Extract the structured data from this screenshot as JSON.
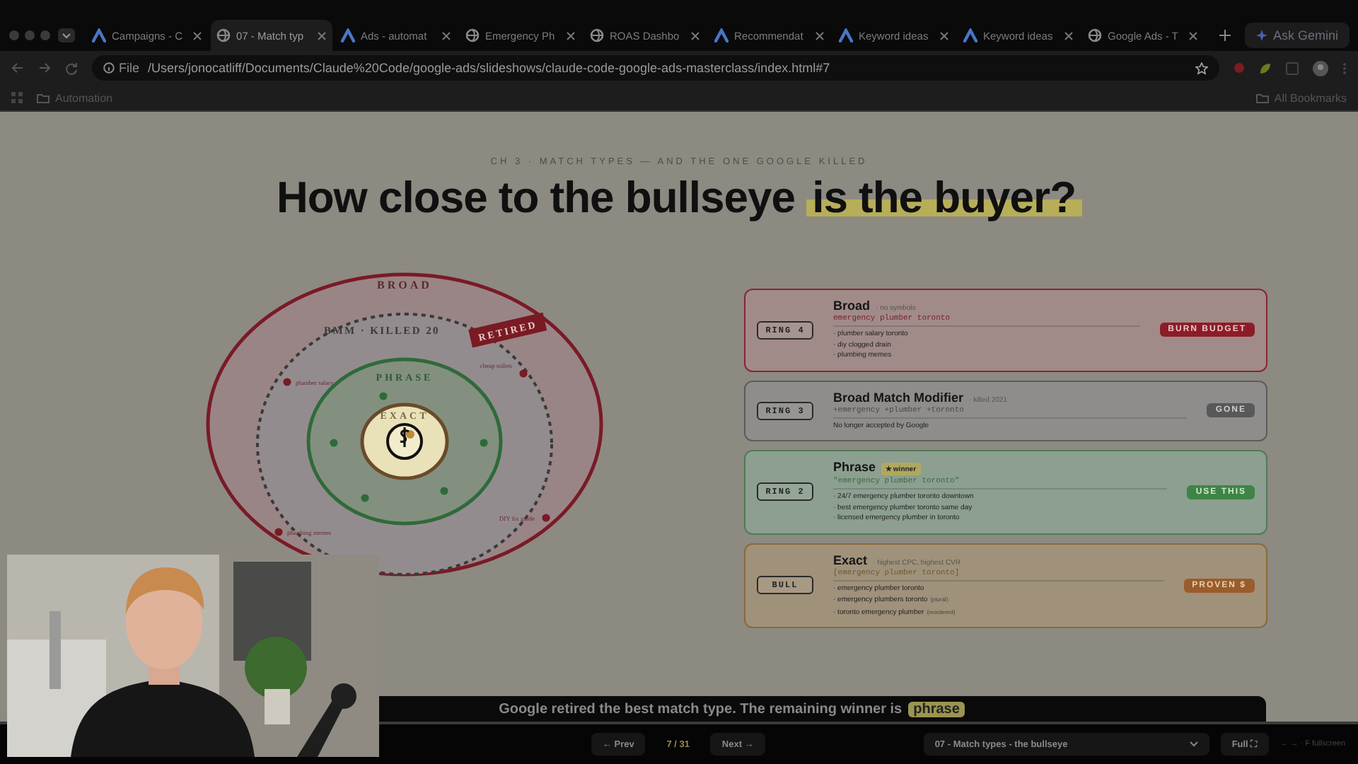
{
  "browser": {
    "tabs": [
      {
        "label": "Campaigns - C",
        "kind": "ads",
        "selected": false
      },
      {
        "label": "07 - Match typ",
        "kind": "globe",
        "selected": true
      },
      {
        "label": "Ads - automat",
        "kind": "ads",
        "selected": false
      },
      {
        "label": "Emergency Ph",
        "kind": "globe",
        "selected": false
      },
      {
        "label": "ROAS Dashbo",
        "kind": "globe",
        "selected": false
      },
      {
        "label": "Recommendat",
        "kind": "ads",
        "selected": false
      },
      {
        "label": "Keyword ideas",
        "kind": "ads",
        "selected": false
      },
      {
        "label": "Keyword ideas",
        "kind": "ads",
        "selected": false
      },
      {
        "label": "Google Ads - T",
        "kind": "globe",
        "selected": false
      }
    ],
    "gemini": "Ask Gemini",
    "scheme": "File",
    "url": "/Users/jonocatliff/Documents/Claude%20Code/google-ads/slideshows/claude-code-google-ads-masterclass/index.html#7",
    "bookmarks": [
      "Automation"
    ],
    "all_bookmarks": "All Bookmarks"
  },
  "slide": {
    "eyebrow": "CH 3 · MATCH TYPES — AND THE ONE GOOGLE KILLED",
    "title": "How close to the bullseye",
    "title_highlight": "is the buyer?",
    "diagram": {
      "broad": "BROAD",
      "bmm": "BMM · KILLED 20",
      "stamp": "RETIRED",
      "phrase": "PHRASE",
      "exact": "EXACT",
      "outliers": [
        "plumber salary",
        "cheap toilets",
        "DIY fix guide",
        "plumbing memes"
      ]
    },
    "cards": [
      {
        "kind": "broad",
        "ring": "RING 4",
        "title": "Broad",
        "note": "· no symbols",
        "query": "emergency plumber toronto",
        "lines": [
          {
            "text": "· plumber salary toronto"
          },
          {
            "text": "· diy clogged drain"
          },
          {
            "text": "· plumbing memes"
          }
        ],
        "pill": "BURN BUDGET"
      },
      {
        "kind": "bmm",
        "ring": "RING 3",
        "title": "Broad Match Modifier",
        "note": "· killed 2021",
        "query": "+emergency +plumber +toronto",
        "lines": [
          {
            "text": "No longer accepted by Google"
          }
        ],
        "pill": "GONE"
      },
      {
        "kind": "phrase",
        "ring": "RING 2",
        "title": "Phrase",
        "badge": "★ winner",
        "query": "\"emergency plumber toronto\"",
        "lines": [
          {
            "text": "· 24/7 emergency plumber toronto downtown"
          },
          {
            "text": "· best emergency plumber toronto same day"
          },
          {
            "text": "· licensed emergency plumber in toronto"
          }
        ],
        "pill": "USE THIS"
      },
      {
        "kind": "exact",
        "ring": "BULL",
        "title": "Exact",
        "note": "· highest CPC, highest CVR",
        "query": "[emergency plumber toronto]",
        "lines": [
          {
            "text": "· emergency plumber toronto"
          },
          {
            "text": "· emergency plumbers toronto",
            "tag": "(plural)"
          },
          {
            "text": "· toronto emergency plumber",
            "tag": "(reordered)"
          }
        ],
        "pill": "PROVEN $"
      }
    ],
    "caption": "Google retired the best match type. The remaining winner is",
    "caption_highlight": "phrase"
  },
  "nav": {
    "prev": "← Prev",
    "counter": "7 / 31",
    "next": "Next →",
    "section": "07 - Match types - the bullseye",
    "full": "Full ⛶",
    "hint": "← → · F fullscreen"
  }
}
